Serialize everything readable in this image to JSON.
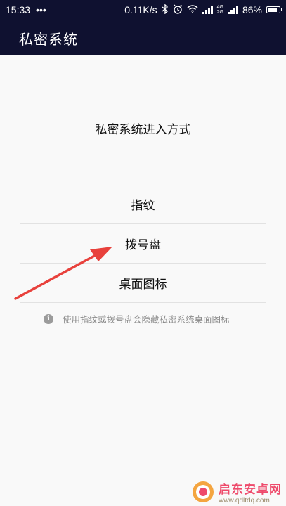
{
  "status_bar": {
    "time": "15:33",
    "dots": "•••",
    "speed": "0.11K/s",
    "network_label_top": "4G",
    "network_label_bottom": "2G",
    "battery": "86%",
    "battery_level": 0.86,
    "icons": [
      "bluetooth-icon",
      "alarm-icon",
      "wifi-icon",
      "signal-icon",
      "signal-icon",
      "battery-icon"
    ]
  },
  "app_bar": {
    "title": "私密系统"
  },
  "main": {
    "section_title": "私密系统进入方式",
    "options": [
      {
        "label": "指纹"
      },
      {
        "label": "拨号盘"
      },
      {
        "label": "桌面图标"
      }
    ],
    "hint_icon": "info-icon",
    "hint_icon_glyph": "i",
    "hint": "使用指纹或拨号盘会隐藏私密系统桌面图标"
  },
  "annotation": {
    "color": "#e8413c"
  },
  "watermark": {
    "name": "启东安卓网",
    "url": "www.qdltdq.com"
  },
  "colors": {
    "header": "#0f1130",
    "background": "#f9f9f9"
  }
}
